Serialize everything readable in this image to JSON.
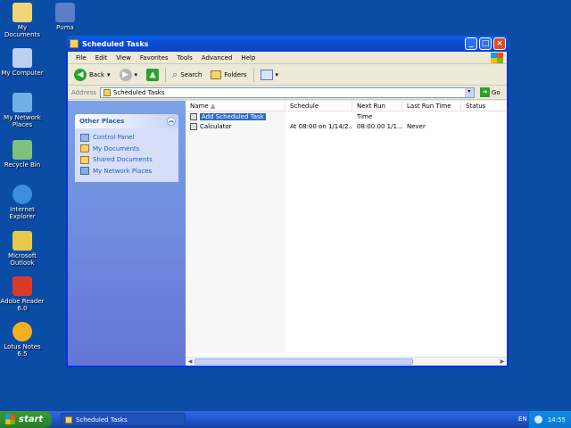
{
  "desktop": {
    "icons": [
      {
        "label": "My Documents",
        "icon": "my-documents-icon",
        "color": "#f1d37a"
      },
      {
        "label": "Puma",
        "icon": "puma-icon",
        "color": "#5a7fc8"
      },
      {
        "label": "My Computer",
        "icon": "my-computer-icon",
        "color": "#bcd0f0"
      },
      {
        "label": "My Network Places",
        "icon": "network-places-icon",
        "color": "#6fb0e8"
      },
      {
        "label": "Recycle Bin",
        "icon": "recycle-bin-icon",
        "color": "#7fc07f"
      },
      {
        "label": "Internet Explorer",
        "icon": "internet-explorer-icon",
        "color": "#3a8de0"
      },
      {
        "label": "Microsoft Outlook",
        "icon": "outlook-icon",
        "color": "#e6c84a"
      },
      {
        "label": "Adobe Reader 6.0",
        "icon": "adobe-reader-icon",
        "color": "#d83a2a"
      },
      {
        "label": "Lotus Notes 6.5",
        "icon": "lotus-notes-icon",
        "color": "#f5b020"
      }
    ]
  },
  "window": {
    "title": "Scheduled Tasks",
    "menu": [
      "File",
      "Edit",
      "View",
      "Favorites",
      "Tools",
      "Advanced",
      "Help"
    ],
    "toolbar": {
      "back_label": "Back",
      "search_label": "Search",
      "folders_label": "Folders"
    },
    "address": {
      "label": "Address",
      "value": "Scheduled Tasks",
      "go_label": "Go"
    },
    "other_places": {
      "title": "Other Places",
      "links": [
        {
          "label": "Control Panel",
          "icon": "control-panel-icon"
        },
        {
          "label": "My Documents",
          "icon": "folder-icon"
        },
        {
          "label": "Shared Documents",
          "icon": "folder-icon"
        },
        {
          "label": "My Network Places",
          "icon": "network-icon"
        }
      ]
    },
    "columns": [
      "Name",
      "Schedule",
      "Next Run Time",
      "Last Run Time",
      "Status"
    ],
    "rows": [
      {
        "name": "Add Scheduled Task",
        "schedule": "",
        "next": "",
        "last": "",
        "status": "",
        "selected": true
      },
      {
        "name": "Calculator",
        "schedule": "At 08:00 on 1/14/2...",
        "next": "08:00:00  1/1...",
        "last": "Never",
        "status": "",
        "selected": false
      }
    ]
  },
  "taskbar": {
    "start_label": "start",
    "task_label": "Scheduled Tasks",
    "lang": "EN",
    "clock": "14:55"
  }
}
